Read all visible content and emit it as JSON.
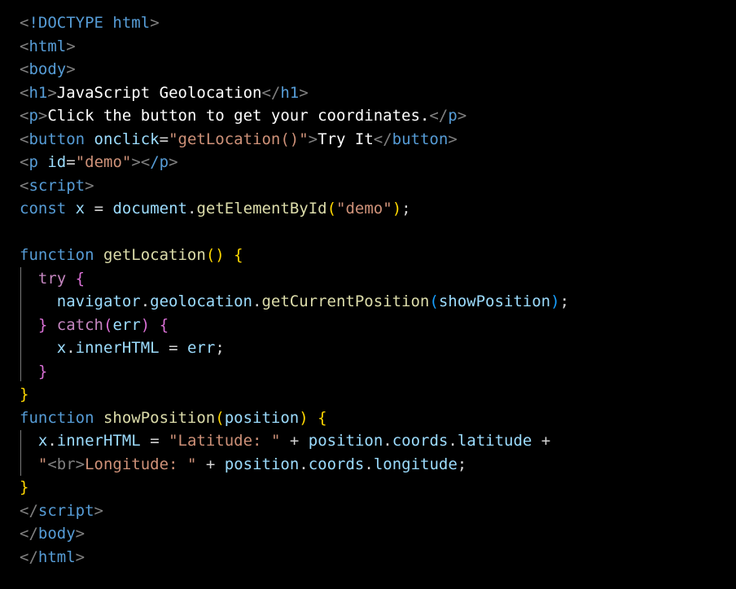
{
  "colors": {
    "background": "#000000",
    "bracket": "#808080",
    "tag": "#569cd6",
    "attribute": "#9cdcfe",
    "string": "#ce9178",
    "keyword": "#569cd6",
    "control": "#c586c0",
    "function": "#dcdcaa",
    "brace_level1": "#ffd700",
    "brace_level2": "#da70d6",
    "brace_level3": "#179fff"
  },
  "code": {
    "l1": {
      "open": "<",
      "doctype": "!DOCTYPE",
      "name": "html",
      "close": ">"
    },
    "l2": {
      "open": "<",
      "tag": "html",
      "close": ">"
    },
    "l3": {
      "open": "<",
      "tag": "body",
      "close": ">"
    },
    "l4": {
      "open": "<",
      "tag": "h1",
      "close": ">",
      "text": "JavaScript Geolocation",
      "end_open": "</",
      "end_tag": "h1",
      "end_close": ">"
    },
    "l5": {
      "open": "<",
      "tag": "p",
      "close": ">",
      "text": "Click the button to get your coordinates.",
      "end_open": "</",
      "end_tag": "p",
      "end_close": ">"
    },
    "l6": {
      "open": "<",
      "tag": "button",
      "attr": "onclick",
      "eq": "=",
      "value": "\"getLocation()\"",
      "close": ">",
      "text": "Try It",
      "end_open": "</",
      "end_tag": "button",
      "end_close": ">"
    },
    "l7": {
      "open": "<",
      "tag": "p",
      "attr": "id",
      "eq": "=",
      "value": "\"demo\"",
      "close": "><",
      "end_tag": "/p",
      "end_close": ">"
    },
    "l8": {
      "open": "<",
      "tag": "script",
      "close": ">"
    },
    "l9": {
      "kw": "const",
      "var": "x",
      "op": "=",
      "obj": "document",
      "dot": ".",
      "fn": "getElementById",
      "p_open": "(",
      "arg": "\"demo\"",
      "p_close": ")",
      "semi": ";"
    },
    "l11": {
      "kw": "function",
      "fn": "getLocation",
      "parens": "()",
      "brace": "{"
    },
    "l12": {
      "kw": "try",
      "brace": "{"
    },
    "l13": {
      "obj": "navigator",
      "dot1": ".",
      "prop": "geolocation",
      "dot2": ".",
      "fn": "getCurrentPosition",
      "p_open": "(",
      "arg": "showPosition",
      "p_close": ")",
      "semi": ";"
    },
    "l14": {
      "brace_close": "}",
      "kw": "catch",
      "p_open": "(",
      "arg": "err",
      "p_close": ")",
      "brace": "{"
    },
    "l15": {
      "obj": "x",
      "dot": ".",
      "prop": "innerHTML",
      "op": "=",
      "val": "err",
      "semi": ";"
    },
    "l16": {
      "brace": "}"
    },
    "l17": {
      "brace": "}"
    },
    "l18": {
      "kw": "function",
      "fn": "showPosition",
      "p_open": "(",
      "arg": "position",
      "p_close": ")",
      "brace": "{"
    },
    "l19": {
      "obj": "x",
      "dot": ".",
      "prop": "innerHTML",
      "op": "=",
      "str": "\"Latitude: \"",
      "plus": "+",
      "obj2": "position",
      "dot2": ".",
      "prop2": "coords",
      "dot3": ".",
      "prop3": "latitude",
      "plus2": "+"
    },
    "l20": {
      "str_a": "\"",
      "str_b": "<br>",
      "str_c": "Longitude: \"",
      "plus": "+",
      "obj": "position",
      "dot": ".",
      "prop": "coords",
      "dot2": ".",
      "prop2": "longitude",
      "semi": ";"
    },
    "l21": {
      "brace": "}"
    },
    "l22": {
      "open": "</",
      "tag": "script",
      "close": ">"
    },
    "l23": {
      "open": "</",
      "tag": "body",
      "close": ">"
    },
    "l24": {
      "open": "</",
      "tag": "html",
      "close": ">"
    }
  }
}
